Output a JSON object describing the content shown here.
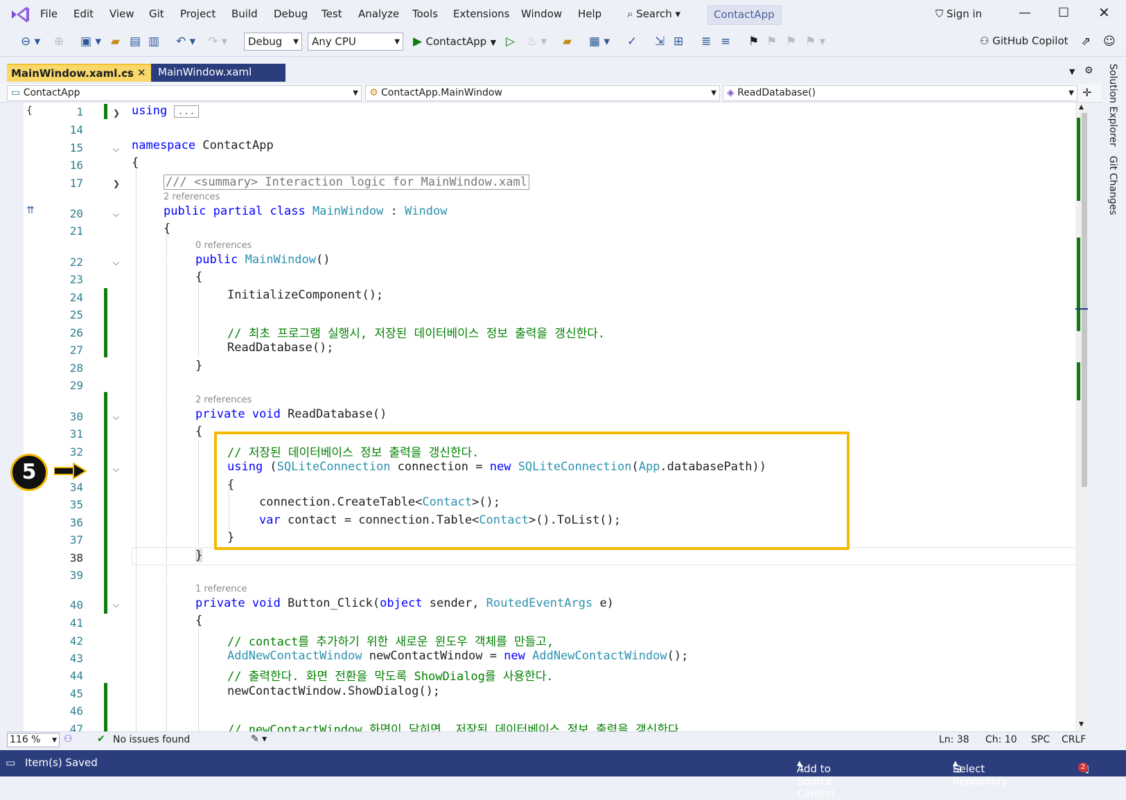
{
  "menu": {
    "items": [
      "File",
      "Edit",
      "View",
      "Git",
      "Project",
      "Build",
      "Debug",
      "Test",
      "Analyze",
      "Tools",
      "Extensions",
      "Window",
      "Help"
    ],
    "search": "Search",
    "title": "ContactApp",
    "sign_in": "Sign in"
  },
  "toolbar": {
    "config": "Debug",
    "platform": "Any CPU",
    "run": "ContactApp",
    "copilot": "GitHub Copilot"
  },
  "tabs": {
    "active": "MainWindow.xaml.cs",
    "inactive": "MainWindow.xaml"
  },
  "nav": {
    "project": "ContactApp",
    "class": "ContactApp.MainWindow",
    "member": "ReadDatabase()"
  },
  "refs": {
    "r2": "2 references",
    "r0": "0 references",
    "r2b": "2 references",
    "r1": "1 reference"
  },
  "lines": [
    "1",
    "14",
    "15",
    "16",
    "17",
    "20",
    "21",
    "22",
    "23",
    "24",
    "25",
    "26",
    "27",
    "28",
    "29",
    "30",
    "31",
    "32",
    "33",
    "34",
    "35",
    "36",
    "37",
    "38",
    "39",
    "40",
    "41",
    "42",
    "43",
    "44",
    "45",
    "46",
    "47"
  ],
  "code": {
    "l1": "using",
    "l1b": "...",
    "l15a": "namespace",
    "l15b": " ContactApp",
    "brace": "{",
    "l17": "/// <summary> Interaction logic for MainWindow.xaml",
    "l20a": "public partial class",
    "l20b": " MainWindow",
    "l20c": " : ",
    "l20d": "Window",
    "l22a": "public",
    "l22b": " MainWindow",
    "l22c": "()",
    "l24": "InitializeComponent();",
    "l26": "// 최초 프로그램 실행시, 저장된 데이터베이스 정보 출력을 갱신한다.",
    "l27": "ReadDatabase();",
    "rbrace": "}",
    "l30a": "private void",
    "l30b": " ReadDatabase()",
    "l32": "// 저장된 데이터베이스 정보 출력을 갱신한다.",
    "l33a": "using",
    "l33b": " (",
    "l33c": "SQLiteConnection",
    "l33d": " connection = ",
    "l33e": "new",
    "l33f": " SQLiteConnection",
    "l33g": "(",
    "l33h": "App",
    ".l33i": "",
    "l33j": ".databasePath))",
    "l35a": "connection.CreateTable<",
    "l35b": "Contact",
    "l35c": ">();",
    "l36a": "var",
    "l36b": " contact = connection.Table<",
    "l36c": "Contact",
    "l36d": ">().ToList();",
    "l38": "}",
    "l40a": "private void",
    "l40b": " Button_Click(",
    "l40c": "object",
    "l40d": " sender, ",
    "l40e": "RoutedEventArgs",
    "l40f": " e)",
    "l42": "// contact를 추가하기 위한 새로운 윈도우 객체를 만들고,",
    "l43a": "AddNewContactWindow",
    "l43b": " newContactWindow = ",
    "l43c": "new",
    "l43d": " AddNewContactWindow",
    "l43e": "();",
    "l44": "// 출력한다. 화면 전환을 막도록 ShowDialog를 사용한다.",
    "l45": "newContactWindow.ShowDialog();",
    "l47": "// newContactWindow 화면이 닫히면, 저장된 데이터베이스 정보 출력을 갱신한다."
  },
  "editor_status": {
    "zoom": "116 %",
    "issues": "No issues found",
    "ln": "Ln: 38",
    "ch": "Ch: 10",
    "spc": "SPC",
    "crlf": "CRLF"
  },
  "side": {
    "solution": "Solution Explorer",
    "git": "Git Changes"
  },
  "status": {
    "saved": "Item(s) Saved",
    "source": "Add to Source Control",
    "repo": "Select Repository",
    "notif": "2"
  },
  "annotation": {
    "badge": "5"
  }
}
